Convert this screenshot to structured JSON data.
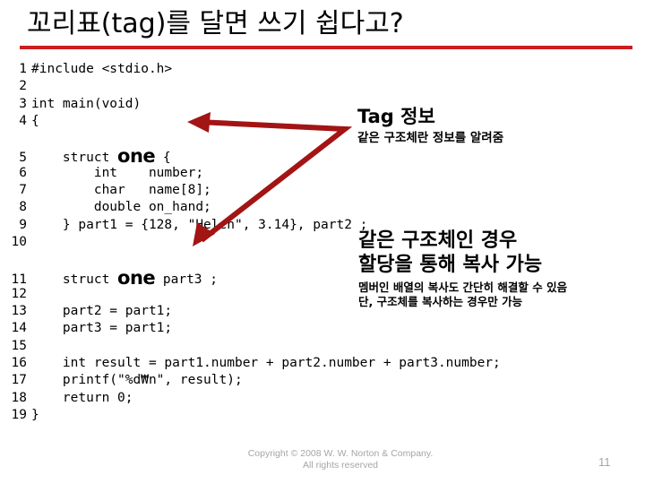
{
  "slide": {
    "title": "꼬리표(tag)를 달면 쓰기 쉽다고?",
    "rule_color": "#C8201F",
    "arrow_color": "#A31414"
  },
  "code": {
    "lines": [
      {
        "number": "1",
        "pre": "#include <stdio.h>",
        "tag": "",
        "post": ""
      },
      {
        "number": "2",
        "pre": "",
        "tag": "",
        "post": ""
      },
      {
        "number": "3",
        "pre": "int main(void)",
        "tag": "",
        "post": ""
      },
      {
        "number": "4",
        "pre": "{",
        "tag": "",
        "post": ""
      },
      {
        "number": "",
        "pre": "",
        "tag": "",
        "post": ""
      },
      {
        "number": "5",
        "pre": "    struct ",
        "tag": "one",
        "post": " {"
      },
      {
        "number": "6",
        "pre": "        int    number;",
        "tag": "",
        "post": ""
      },
      {
        "number": "7",
        "pre": "        char   name[8];",
        "tag": "",
        "post": ""
      },
      {
        "number": "8",
        "pre": "        double on_hand;",
        "tag": "",
        "post": ""
      },
      {
        "number": "9",
        "pre": "    } part1 = {128, \"Helen\", 3.14}, part2 ;",
        "tag": "",
        "post": ""
      },
      {
        "number": "10",
        "pre": "",
        "tag": "",
        "post": ""
      },
      {
        "number": "",
        "pre": "",
        "tag": "",
        "post": ""
      },
      {
        "number": "11",
        "pre": "    struct ",
        "tag": "one",
        "post": " part3 ;"
      },
      {
        "number": "12",
        "pre": "",
        "tag": "",
        "post": ""
      },
      {
        "number": "13",
        "pre": "    part2 = part1;",
        "tag": "",
        "post": ""
      },
      {
        "number": "14",
        "pre": "    part3 = part1;",
        "tag": "",
        "post": ""
      },
      {
        "number": "15",
        "pre": "",
        "tag": "",
        "post": ""
      },
      {
        "number": "16",
        "pre": "    int result = part1.number + part2.number + part3.number;",
        "tag": "",
        "post": ""
      },
      {
        "number": "17",
        "pre": "    printf(\"%d₩n\", result);",
        "tag": "",
        "post": ""
      },
      {
        "number": "18",
        "pre": "    return 0;",
        "tag": "",
        "post": ""
      },
      {
        "number": "19",
        "pre": "}",
        "tag": "",
        "post": ""
      }
    ]
  },
  "callout_tag": {
    "heading": "Tag 정보",
    "subtext": "같은 구조체란 정보를 알려줌"
  },
  "callout_copy": {
    "heading_line1": "같은 구조체인 경우",
    "heading_line2": "할당을 통해 복사 가능",
    "subtext_line1": "멤버인 배열의 복사도 간단히 해결할 수 있음",
    "subtext_line2": "단, 구조체를 복사하는 경우만 가능"
  },
  "footer": {
    "copyright_line1": "Copyright © 2008 W. W. Norton & Company.",
    "copyright_line2": "All rights reserved",
    "page_number": "11"
  }
}
